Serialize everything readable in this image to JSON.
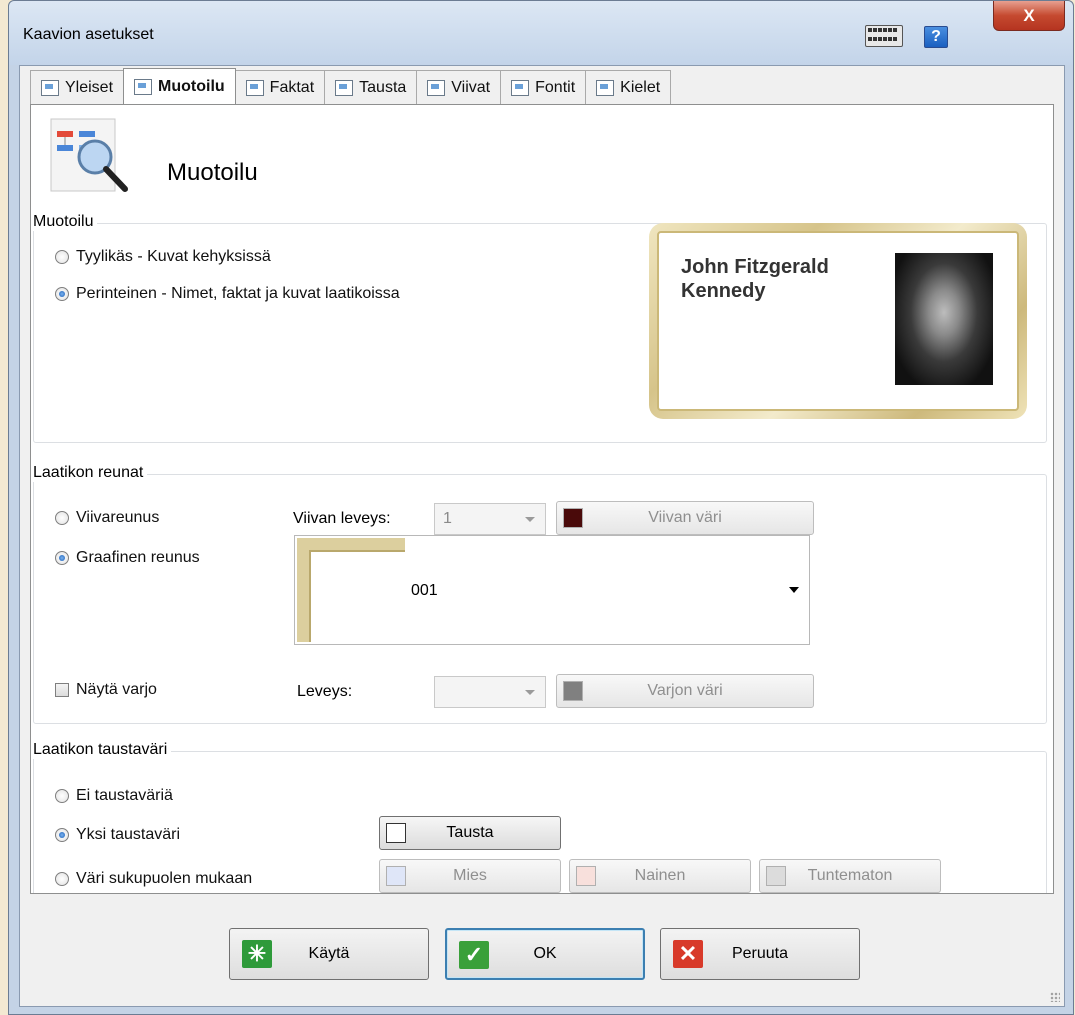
{
  "window": {
    "title": "Kaavion asetukset",
    "close_label": "X",
    "help_label": "?"
  },
  "tabs": [
    {
      "label": "Yleiset",
      "icon": "gear-icon"
    },
    {
      "label": "Muotoilu",
      "icon": "magnifier-icon",
      "active": true
    },
    {
      "label": "Faktat",
      "icon": "facts-icon"
    },
    {
      "label": "Tausta",
      "icon": "background-icon"
    },
    {
      "label": "Viivat",
      "icon": "lines-icon"
    },
    {
      "label": "Fontit",
      "icon": "font-icon"
    },
    {
      "label": "Kielet",
      "icon": "language-icon"
    }
  ],
  "header": {
    "title": "Muotoilu",
    "icon": "chart-magnifier-icon"
  },
  "format_group": {
    "label": "Muotoilu",
    "options": [
      {
        "label": "Tyylikäs - Kuvat kehyksissä",
        "selected": false
      },
      {
        "label": "Perinteinen - Nimet, faktat ja kuvat laatikoissa",
        "selected": true
      }
    ],
    "preview_name": "John Fitzgerald Kennedy"
  },
  "border_group": {
    "label": "Laatikon reunat",
    "line_border_label": "Viivareunus",
    "line_border_selected": false,
    "line_width_label": "Viivan leveys:",
    "line_width_value": "1",
    "line_color_label": "Viivan väri",
    "line_color": "#4a0a0a",
    "graphic_border_label": "Graafinen reunus",
    "graphic_border_selected": true,
    "graphic_border_value": "001",
    "shadow_label": "Näytä varjo",
    "shadow_checked": false,
    "shadow_width_label": "Leveys:",
    "shadow_width_value": "",
    "shadow_color_label": "Varjon väri",
    "shadow_color": "#808080"
  },
  "background_group": {
    "label": "Laatikon taustaväri",
    "options": [
      {
        "label": "Ei taustaväriä",
        "selected": false
      },
      {
        "label": "Yksi taustaväri",
        "selected": true
      },
      {
        "label": "Väri sukupuolen mukaan",
        "selected": false
      }
    ],
    "single_color_button": "Tausta",
    "single_color": "#ffffff",
    "gender_buttons": [
      {
        "label": "Mies",
        "color": "#dfe6f8"
      },
      {
        "label": "Nainen",
        "color": "#f8e0dc"
      },
      {
        "label": "Tuntematon",
        "color": "#dcdcdc"
      }
    ]
  },
  "footer": {
    "apply_label": "Käytä",
    "ok_label": "OK",
    "cancel_label": "Peruuta"
  }
}
